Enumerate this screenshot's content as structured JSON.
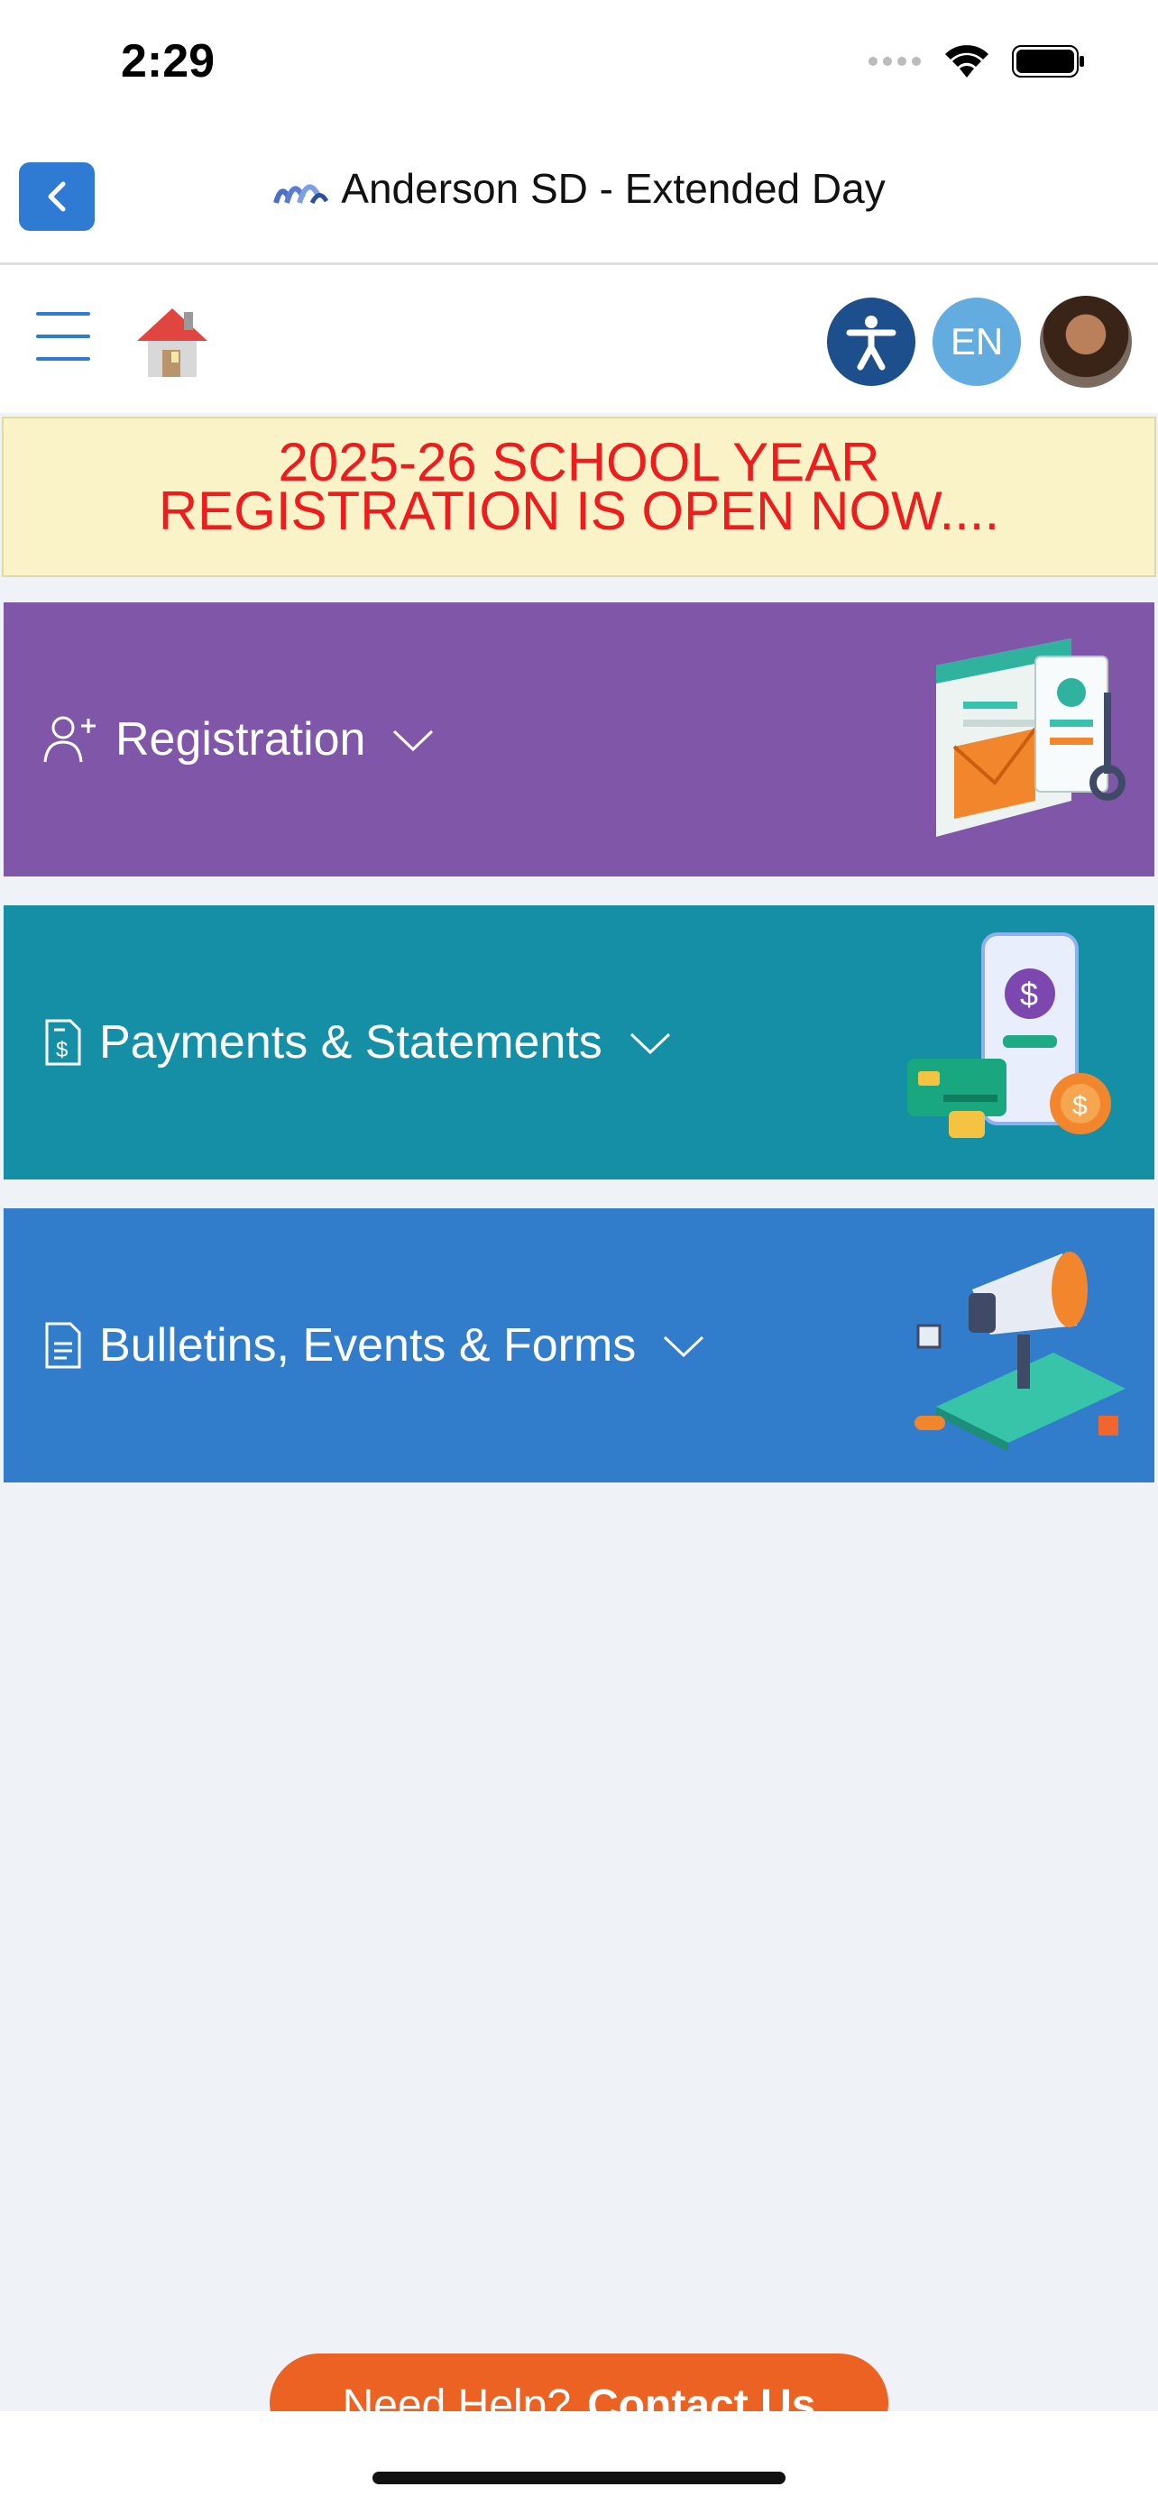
{
  "status_bar": {
    "time": "2:29"
  },
  "nav": {
    "title": "Anderson SD - Extended Day"
  },
  "toolbar": {
    "language": "EN"
  },
  "banner": {
    "line1": "2025-26 SCHOOL YEAR",
    "line2": "REGISTRATION IS OPEN NOW...."
  },
  "cards": [
    {
      "label": "Registration",
      "icon": "user-plus-icon",
      "color": "#8057a8"
    },
    {
      "label": "Payments & Statements",
      "icon": "dollar-document-icon",
      "color": "#158fa5"
    },
    {
      "label": "Bulletins, Events & Forms",
      "icon": "document-icon",
      "color": "#317dcc"
    }
  ],
  "help": {
    "prefix": "Need Help?",
    "link": "Contact Us"
  }
}
